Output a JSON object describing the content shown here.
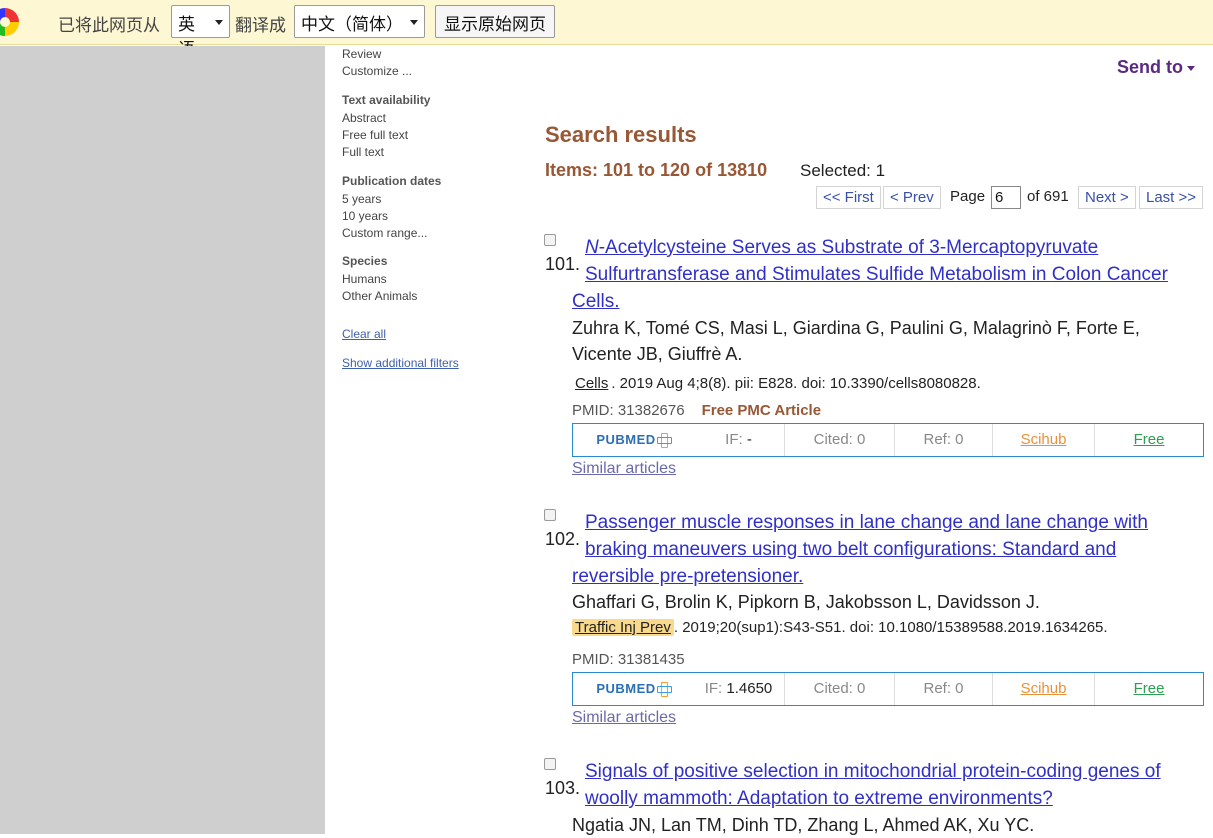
{
  "translate_bar": {
    "from_label": "已将此网页从",
    "from_lang": "英语",
    "to_label": "翻译成",
    "to_lang": "中文（简体）",
    "show_original": "显示原始网页"
  },
  "filters": {
    "article_types": [
      "Review",
      "Customize ..."
    ],
    "text_availability": {
      "heading": "Text availability",
      "items": [
        "Abstract",
        "Free full text",
        "Full text"
      ]
    },
    "publication_dates": {
      "heading": "Publication dates",
      "items": [
        "5 years",
        "10 years",
        "Custom range..."
      ]
    },
    "species": {
      "heading": "Species",
      "items": [
        "Humans",
        "Other Animals"
      ]
    },
    "clear_all": "Clear all",
    "show_additional": "Show additional filters"
  },
  "header": {
    "send_to": "Send to",
    "title": "Search results",
    "items_text": "Items: 101 to 120 of 13810",
    "selected_text": "Selected: 1"
  },
  "pager": {
    "first": "<< First",
    "prev": "< Prev",
    "page_label": "Page",
    "page_value": "6",
    "of_label": "of 691",
    "next": "Next >",
    "last": "Last >>"
  },
  "results": [
    {
      "num": "101.",
      "title_italic": "N",
      "title_line1": "-Acetylcysteine Serves as Substrate of 3-Mercaptopyruvate",
      "title_line2": "Sulfurtransferase and Stimulates Sulfide Metabolism in Colon Cancer",
      "title_line3": "Cells.",
      "authors_line1": "Zuhra K, Tomé CS, Masi L, Giardina G, Paulini G, Malagrinò F, Forte E,",
      "authors_line2": "Vicente JB, Giuffrè A.",
      "journal": "Cells",
      "citation": ". 2019 Aug 4;8(8). pii: E828. doi: 10.3390/cells8080828.",
      "pmid": "PMID: 31382676",
      "free_pmc": "Free PMC Article",
      "toolbar": {
        "logo": "PUBMED",
        "if_label": "IF:",
        "if_value": "-",
        "cited": "Cited: 0",
        "ref": "Ref: 0",
        "scihub": "Scihub",
        "free": "Free"
      },
      "similar": "Similar articles"
    },
    {
      "num": "102.",
      "title_line1": "Passenger muscle responses in lane change and lane change with",
      "title_line2": "braking maneuvers using two belt configurations: Standard and",
      "title_line3": "reversible pre-pretensioner.",
      "authors_line1": "Ghaffari G, Brolin K, Pipkorn B, Jakobsson L, Davidsson J.",
      "journal": "Traffic Inj Prev",
      "citation": ". 2019;20(sup1):S43-S51. doi: 10.1080/15389588.2019.1634265.",
      "pmid": "PMID: 31381435",
      "toolbar": {
        "logo": "PUBMED",
        "if_label": "IF:",
        "if_value": "1.4650",
        "cited": "Cited: 0",
        "ref": "Ref: 0",
        "scihub": "Scihub",
        "free": "Free"
      },
      "similar": "Similar articles"
    },
    {
      "num": "103.",
      "title_line1": "Signals of positive selection in mitochondrial protein-coding genes of",
      "title_line2": "woolly mammoth: Adaptation to extreme environments?",
      "authors_line1": "Ngatia JN, Lan TM, Dinh TD, Zhang L, Ahmed AK, Xu YC."
    }
  ]
}
